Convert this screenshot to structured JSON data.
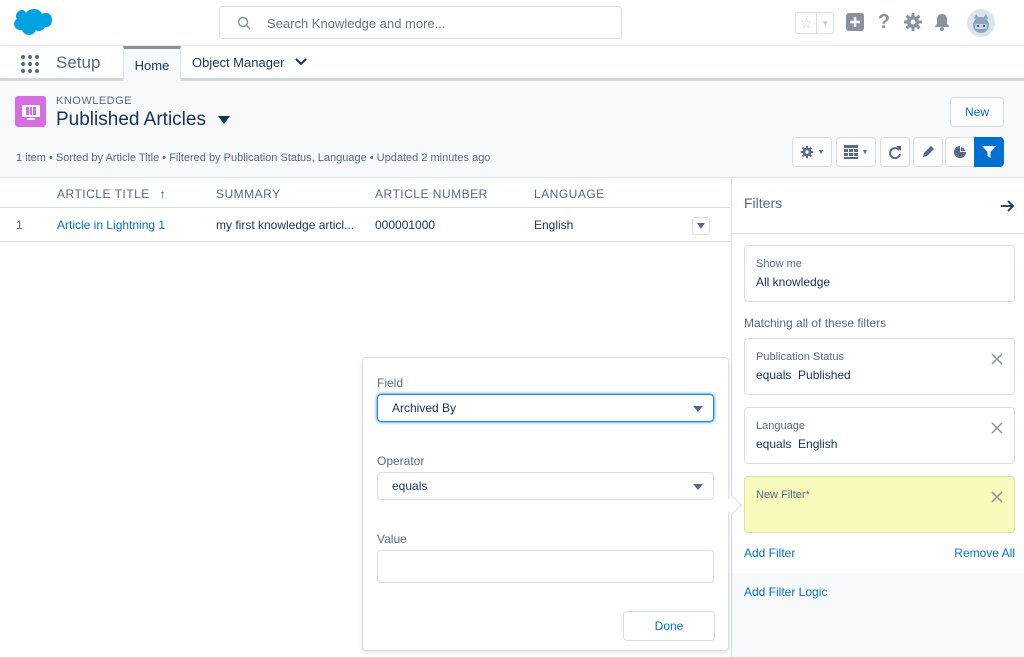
{
  "global_header": {
    "search_placeholder": "Search Knowledge and more..."
  },
  "nav": {
    "app_name": "Setup",
    "tabs": [
      {
        "label": "Home",
        "active": true
      },
      {
        "label": "Object Manager",
        "has_menu": true
      }
    ]
  },
  "list_header": {
    "object_label": "KNOWLEDGE",
    "list_view_name": "Published Articles",
    "meta": "1 item • Sorted by Article Title • Filtered by Publication Status, Language • Updated 2 minutes ago",
    "new_button": "New",
    "accent_color": "#0070d2",
    "object_icon_color": "#d66ee0"
  },
  "table": {
    "columns": [
      "ARTICLE TITLE",
      "SUMMARY",
      "ARTICLE NUMBER",
      "LANGUAGE"
    ],
    "sort_indicator": "↑",
    "rows": [
      {
        "num": "1",
        "title": "Article in Lightning 1",
        "summary": "my first knowledge articl...",
        "article_number": "000001000",
        "language": "English"
      }
    ]
  },
  "filters": {
    "title": "Filters",
    "show_me_label": "Show me",
    "show_me_value": "All knowledge",
    "matching_label": "Matching all of these filters",
    "items": [
      {
        "label": "Publication Status",
        "value": "equals  Published"
      },
      {
        "label": "Language",
        "value": "equals  English"
      },
      {
        "label": "New Filter*",
        "value": ""
      }
    ],
    "add_filter": "Add Filter",
    "remove_all": "Remove All",
    "add_filter_logic": "Add Filter Logic"
  },
  "popover": {
    "field_label": "Field",
    "field_value": "Archived By",
    "operator_label": "Operator",
    "operator_value": "equals",
    "value_label": "Value",
    "value_value": "",
    "done_button": "Done"
  }
}
